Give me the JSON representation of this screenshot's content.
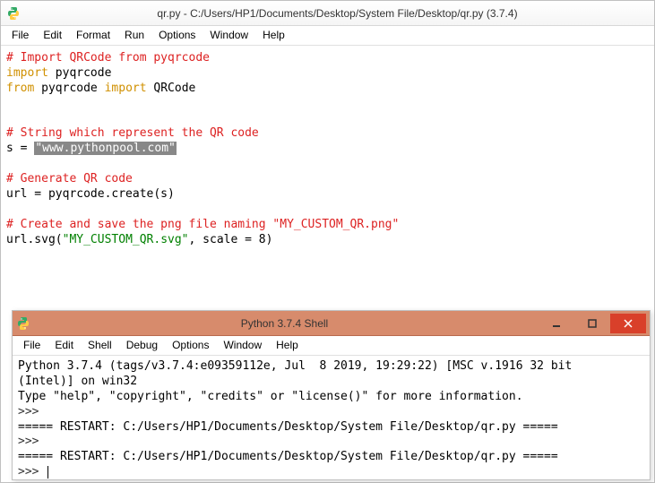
{
  "main_window": {
    "title": "qr.py - C:/Users/HP1/Documents/Desktop/System File/Desktop/qr.py (3.7.4)",
    "menu": [
      "File",
      "Edit",
      "Format",
      "Run",
      "Options",
      "Window",
      "Help"
    ]
  },
  "code": {
    "l1_cm": "# Import QRCode from pyqrcode",
    "l2_kw1": "import",
    "l2_t": " pyqrcode",
    "l3_kw1": "from",
    "l3_t1": " pyqrcode ",
    "l3_kw2": "import",
    "l3_t2": " QRCode",
    "l5_cm": "# String which represent the QR code",
    "l6_t1": "s = ",
    "l6_str": "\"www.pythonpool.com\"",
    "l8_cm": "# Generate QR code",
    "l9": "url = pyqrcode.create(s)",
    "l11_cm": "# Create and save the png file naming \"MY_CUSTOM_QR.png\"",
    "l12_t1": "url.svg(",
    "l12_str": "\"MY_CUSTOM_QR.svg\"",
    "l12_t2": ", scale = 8)"
  },
  "shell_window": {
    "title": "Python 3.7.4 Shell",
    "menu": [
      "File",
      "Edit",
      "Shell",
      "Debug",
      "Options",
      "Window",
      "Help"
    ]
  },
  "shell": {
    "line1": "Python 3.7.4 (tags/v3.7.4:e09359112e, Jul  8 2019, 19:29:22) [MSC v.1916 32 bit",
    "line2": "(Intel)] on win32",
    "line3": "Type \"help\", \"copyright\", \"credits\" or \"license()\" for more information.",
    "prompt": ">>>",
    "restart": "===== RESTART: C:/Users/HP1/Documents/Desktop/System File/Desktop/qr.py ====="
  }
}
